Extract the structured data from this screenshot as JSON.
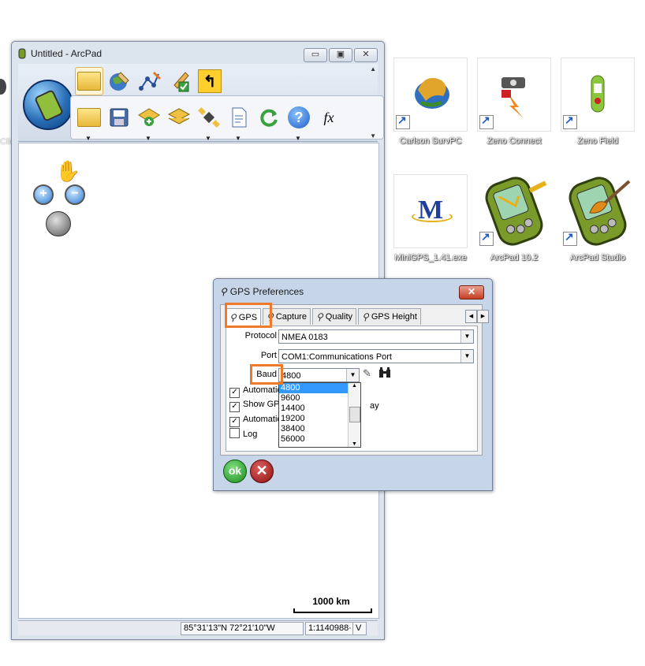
{
  "desktop": {
    "edge_labels": [
      "Clic",
      ""
    ],
    "icons": [
      {
        "label": "Carlson SurvPC",
        "icon": "carlson-survpc-icon",
        "shortcut": true
      },
      {
        "label": "Zeno Connect",
        "icon": "zeno-connect-icon",
        "shortcut": true
      },
      {
        "label": "Zeno Field",
        "icon": "zeno-field-icon",
        "shortcut": true
      },
      {
        "label": "MiniGPS_1.41.exe",
        "icon": "minigps-icon",
        "shortcut": false,
        "glyph": "M"
      },
      {
        "label": "ArcPad 10.2",
        "icon": "arcpad-icon",
        "shortcut": true
      },
      {
        "label": "ArcPad Studio",
        "icon": "arcpad-studio-icon",
        "shortcut": true
      }
    ]
  },
  "arcpad": {
    "title": "Untitled - ArcPad",
    "caption_buttons": {
      "minimize": "▭",
      "maximize": "▣",
      "close": "✕"
    },
    "toolbar": {
      "row1": [
        "folder-icon",
        "globe-edit-icon",
        "edit-vertices-icon",
        "pencil-check-icon",
        "undo-icon"
      ],
      "row2": [
        "open-folder-icon",
        "save-icon",
        "add-layer-icon",
        "layers-icon",
        "gps-satellite-icon",
        "document-icon",
        "refresh-icon",
        "help-icon",
        "expression-icon"
      ],
      "fx_label": "fx",
      "help_label": "?"
    },
    "map": {
      "scale_label": "1000 km"
    },
    "status": {
      "coordinates": "85°31'13\"N 72°21'10\"W",
      "scale": "1:1140988·",
      "extra": "V"
    }
  },
  "gps_dialog": {
    "title": "GPS Preferences",
    "tabs": [
      "GPS",
      "Capture",
      "Quality",
      "GPS Height"
    ],
    "fields": {
      "protocol_label": "Protocol",
      "protocol_value": "NMEA 0183",
      "port_label": "Port",
      "port_value": "COM1:Communications Port",
      "baud_label": "Baud",
      "baud_value": "4800"
    },
    "baud_options": [
      "4800",
      "9600",
      "14400",
      "19200",
      "38400",
      "56000"
    ],
    "checkboxes": [
      {
        "label": "Automatic",
        "checked": true
      },
      {
        "label": "Show GPS",
        "checked": true
      },
      {
        "label": "Automatic",
        "checked": true
      },
      {
        "label": "Log",
        "checked": false
      }
    ],
    "hidden_text_right": "ay",
    "ok_label": "ok",
    "cancel_label": "✕",
    "highlight_color": "#f07a2c"
  }
}
